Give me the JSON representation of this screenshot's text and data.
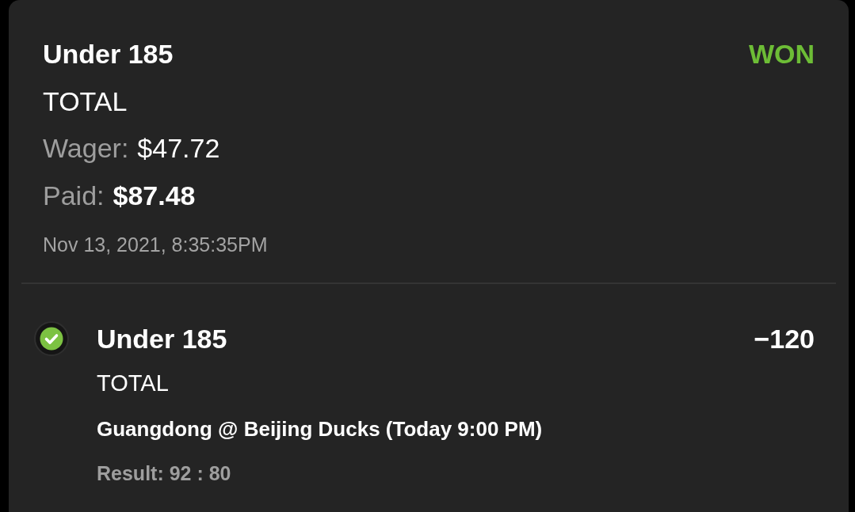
{
  "bet": {
    "selection": "Under 185",
    "status": {
      "label": "WON",
      "kind": "won"
    },
    "market": "TOTAL",
    "wager": {
      "label": "Wager:",
      "value": "$47.72"
    },
    "paid": {
      "label": "Paid:",
      "value": "$87.48"
    },
    "placed_at": "Nov 13, 2021, 8:35:35PM"
  },
  "legs": [
    {
      "won": true,
      "selection": "Under 185",
      "odds": "−120",
      "market": "TOTAL",
      "event": "Guangdong @ Beijing Ducks (Today 9:00 PM)",
      "result": "Result: 92 : 80"
    }
  ]
}
